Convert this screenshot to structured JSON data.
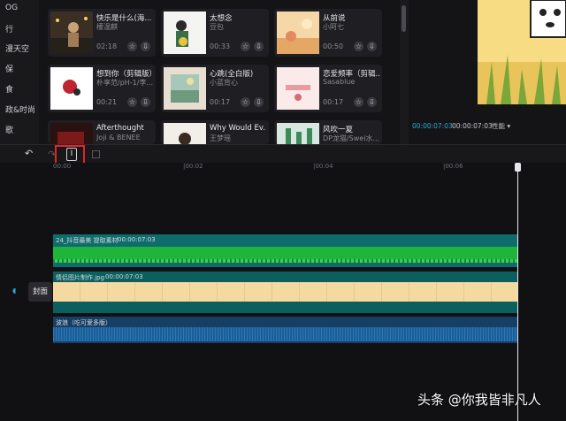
{
  "sidebar": {
    "items": [
      {
        "label": "OG"
      },
      {
        "label": "行"
      },
      {
        "label": "漫天空"
      },
      {
        "label": "保"
      },
      {
        "label": "食"
      },
      {
        "label": "政&时尚"
      },
      {
        "label": "歌"
      }
    ]
  },
  "music": {
    "tracks": [
      {
        "title": "快乐是什么(海...",
        "artist": "檬温麒",
        "duration": "02:18"
      },
      {
        "title": "太想念",
        "artist": "豆包",
        "duration": "00:33"
      },
      {
        "title": "从前说",
        "artist": "小阿七",
        "duration": "00:50"
      },
      {
        "title": "想到你（剪辑版）",
        "artist": "朴享范/pH-1/李...",
        "duration": "00:21"
      },
      {
        "title": "心跳(全白版)",
        "artist": "小蓝背心",
        "duration": "00:17"
      },
      {
        "title": "恋爱频率（剪辑...",
        "artist": "Sasablue",
        "duration": "00:17"
      },
      {
        "title": "Afterthought",
        "artist": "Joji & BENEE",
        "duration": ""
      },
      {
        "title": "Why Would Ev...",
        "artist": "王梦瑶",
        "duration": ""
      },
      {
        "title": "风吹一夏",
        "artist": "DP龙猫/Swei水...",
        "duration": ""
      }
    ]
  },
  "preview": {
    "current_time": "00:00:07:03",
    "total_time": "00:00:07:03",
    "ratio_label": "性能"
  },
  "timeline": {
    "ticks": [
      "00:00",
      "|00:02",
      "|00:04",
      "|00:06"
    ],
    "track1_label": "24_抖音最美 提取素材",
    "track1_duration": "00:00:07:03",
    "track2_label": "情侣图片制作.jpg",
    "track2_duration": "00:00:07:03",
    "track3_label": "波浪（吃可爱多版）",
    "cover_label": "封面"
  },
  "watermark": "头条 @你我皆非凡人",
  "colors": {
    "video_track": "#15a03a",
    "image_track": "#0d6b6b",
    "audio_track": "#1a4f7a",
    "highlight_box": "#e0262a"
  }
}
